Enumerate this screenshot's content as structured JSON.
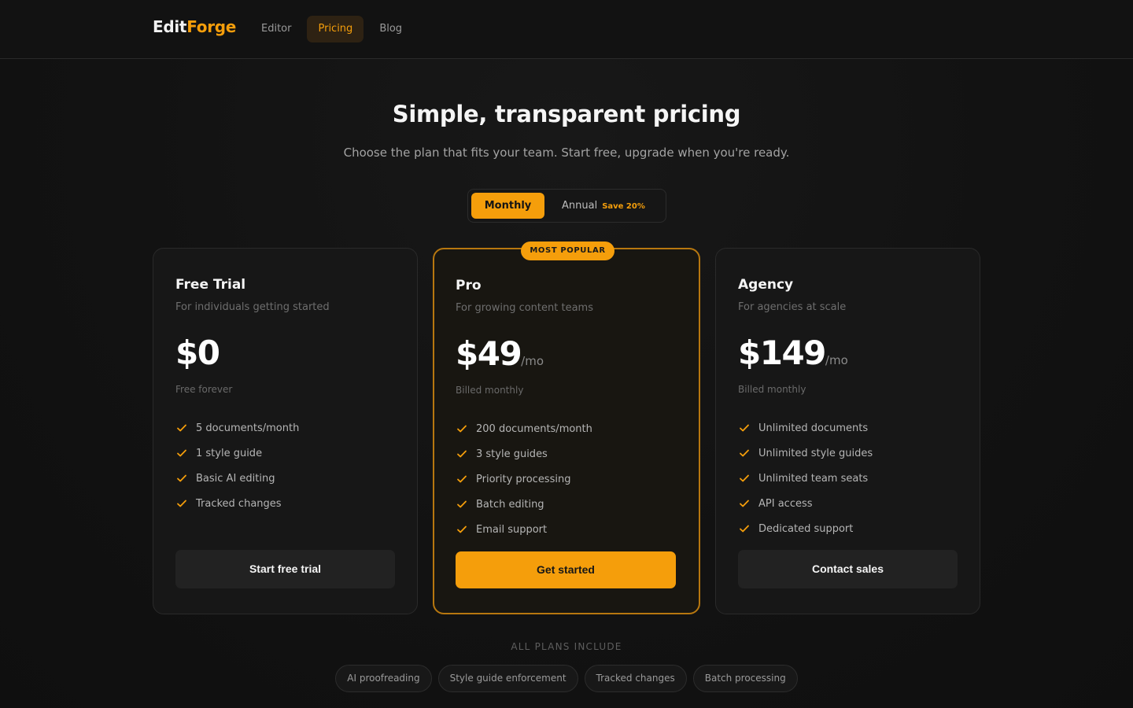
{
  "brand": {
    "name_part1": "Edit",
    "name_part2": "Forge",
    "accent_color": "#f59e0b"
  },
  "nav": {
    "items": [
      {
        "label": "Editor",
        "active": false
      },
      {
        "label": "Pricing",
        "active": true
      },
      {
        "label": "Blog",
        "active": false
      }
    ]
  },
  "hero": {
    "title": "Simple, transparent pricing",
    "subtitle": "Choose the plan that fits your team. Start free, upgrade when you're ready."
  },
  "billing_toggle": {
    "monthly_label": "Monthly",
    "annual_label": "Annual",
    "annual_badge": "Save 20%",
    "selected": "Monthly"
  },
  "plans": [
    {
      "name": "Free Trial",
      "description": "For individuals getting started",
      "price": "$0",
      "period": "",
      "billing_note": "Free forever",
      "features": [
        "5 documents/month",
        "1 style guide",
        "Basic AI editing",
        "Tracked changes"
      ],
      "cta": "Start free trial"
    },
    {
      "name": "Pro",
      "badge": "MOST POPULAR",
      "description": "For growing content teams",
      "price": "$49",
      "period": "/mo",
      "billing_note": "Billed monthly",
      "features": [
        "200 documents/month",
        "3 style guides",
        "Priority processing",
        "Batch editing",
        "Email support"
      ],
      "cta": "Get started"
    },
    {
      "name": "Agency",
      "description": "For agencies at scale",
      "price": "$149",
      "period": "/mo",
      "billing_note": "Billed monthly",
      "features": [
        "Unlimited documents",
        "Unlimited style guides",
        "Unlimited team seats",
        "API access",
        "Dedicated support"
      ],
      "cta": "Contact sales"
    }
  ],
  "all_plans": {
    "label": "ALL PLANS INCLUDE",
    "items": [
      "AI proofreading",
      "Style guide enforcement",
      "Tracked changes",
      "Batch processing"
    ]
  }
}
